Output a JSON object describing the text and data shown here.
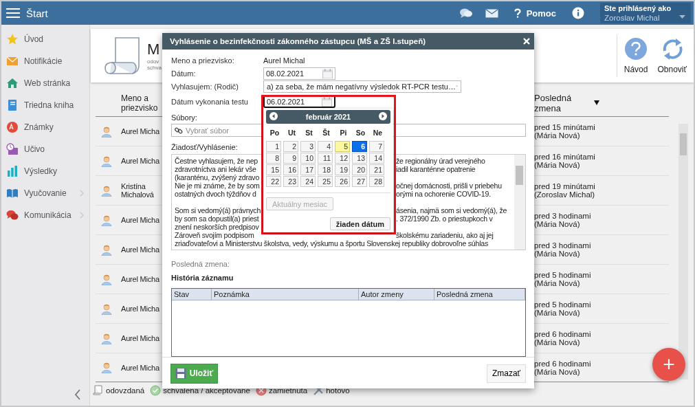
{
  "topbar": {
    "title": "Štart",
    "help": "Pomoc",
    "user_label": "Ste prihlásený ako",
    "user_name": "Zoroslav Michal"
  },
  "sidebar": {
    "items": [
      {
        "label": "Úvod",
        "expandable": false
      },
      {
        "label": "Notifikácie",
        "expandable": false
      },
      {
        "label": "Web stránka",
        "expandable": false
      },
      {
        "label": "Triedna kniha",
        "expandable": false
      },
      {
        "label": "Známky",
        "expandable": false
      },
      {
        "label": "Učivo",
        "expandable": false
      },
      {
        "label": "Výsledky",
        "expandable": false
      },
      {
        "label": "Vyučovanie",
        "expandable": true
      },
      {
        "label": "Komunikácia",
        "expandable": true
      }
    ]
  },
  "page_header": {
    "title": "M",
    "subtitle_lines": [
      "odov",
      "schva"
    ],
    "actions": [
      "Návod",
      "Obnoviť"
    ]
  },
  "list": {
    "columns": [
      "Meno a priezvisko",
      "Posledná zmena"
    ],
    "rows": [
      {
        "name": "Aurel Micha",
        "change": "pred 15 minútami",
        "author": "(Mária Nová)"
      },
      {
        "name": "Aurel Micha",
        "change": "pred 16 minútami",
        "author": "(Mária Nová)"
      },
      {
        "name": "Kristína Michalová",
        "change": "pred 19 minútami",
        "author": "(Zoroslav Michal)"
      },
      {
        "name": "Aurel Micha",
        "change": "pred 3 hodinami",
        "author": "(Mária Nová)"
      },
      {
        "name": "Aurel Micha",
        "change": "pred 3 hodinami",
        "author": "(Mária Nová)"
      },
      {
        "name": "Aurel Micha",
        "change": "pred 5 hodinami",
        "author": "(Mária Nová)"
      },
      {
        "name": "Aurel Micha",
        "change": "pred 5 hodinami",
        "author": "(Mária Nová)"
      },
      {
        "name": "Aurel Micha",
        "change": "pred 6 hodinami",
        "author": "(Mária Nová)"
      },
      {
        "name": "Aurel Micha",
        "change": "pred 6 hodinami",
        "author": "(Mária Nová)"
      }
    ]
  },
  "legend": [
    "odovzdaná",
    "schvalena / akceptovane",
    "zamietnuta",
    "hotovo"
  ],
  "fab": "+",
  "modal": {
    "title": "Vyhlásenie o bezinfekčnosti zákonného zástupcu (MŠ a ZŠ I.stupeň)",
    "name_label": "Meno a priezvisko:",
    "name_value": "Aurel Michal",
    "date_label": "Dátum:",
    "date_value": "08.02.2021",
    "declare_label": "Vyhlasujem: (Rodič)",
    "declare_value": "a) za seba, že mám negatívny výsledok RT-PCR testu…",
    "test_date_label": "Dátum vykonania testu",
    "test_date_value": "06.02.2021",
    "test_date_focused": true,
    "files_label": "Súbory:",
    "files_placeholder": "Vybrať súbor",
    "request_label": "Žiadosť/Vyhlásenie:",
    "request_lines": [
      {
        "left": "Čestne vyhlasujem, že nep",
        "right": "že regionálny úrad verejného"
      },
      {
        "left": "zdravotníctva ani lekár vše",
        "right": "iadil karanténne opatrenie"
      },
      {
        "left": "(karanténu, zvýšený zdravo"
      },
      {
        "left": "Nie je mi známe, že by som",
        "right": "očnej domácnosti, prišli v priebehu"
      },
      {
        "left": "ostatných dvoch týždňov d",
        "right": "orými na ochorenie COVID-19."
      },
      {
        "left": "Som si vedomý(á) právnych",
        "right": "ásenia, najmä som si vedomý(á), že",
        "paragraph_start": true
      },
      {
        "left": "by som sa dopustil(a) priest",
        "right": ". 372/1990 Zb. o priestupkoch v"
      },
      {
        "left": "znení neskorších predpisov"
      },
      {
        "left": "Zároveň svojím podpisom",
        "right": "školskému zariadeniu, ako aj jej"
      },
      {
        "left": "zriaďovateľovi a Ministerstvu školstva, vedy, výskumu a športu Slovenskej republiky dobrovoľne súhlas"
      }
    ],
    "last_change_label": "Posledná zmena:",
    "history_title": "História záznamu",
    "history_columns": [
      "Stav",
      "Poznámka",
      "Autor zmeny",
      "Posledná zmena"
    ],
    "save": "Uložiť",
    "delete": "Zmazať"
  },
  "calendar": {
    "month": "február 2021",
    "weekdays": [
      "Po",
      "Ut",
      "St",
      "Št",
      "Pi",
      "So",
      "Ne"
    ],
    "days": [
      {
        "label": "1",
        "selected": false,
        "today": false
      },
      {
        "label": "2",
        "selected": false,
        "today": false
      },
      {
        "label": "3",
        "selected": false,
        "today": false
      },
      {
        "label": "4",
        "selected": false,
        "today": false
      },
      {
        "label": "5",
        "selected": false,
        "today": true
      },
      {
        "label": "6",
        "selected": true,
        "today": false
      },
      {
        "label": "7",
        "selected": false,
        "today": false
      },
      {
        "label": "8",
        "selected": false,
        "today": false
      },
      {
        "label": "9",
        "selected": false,
        "today": false
      },
      {
        "label": "10",
        "selected": false,
        "today": false
      },
      {
        "label": "11",
        "selected": false,
        "today": false
      },
      {
        "label": "12",
        "selected": false,
        "today": false
      },
      {
        "label": "13",
        "selected": false,
        "today": false
      },
      {
        "label": "14",
        "selected": false,
        "today": false
      },
      {
        "label": "15",
        "selected": false,
        "today": false
      },
      {
        "label": "16",
        "selected": false,
        "today": false
      },
      {
        "label": "17",
        "selected": false,
        "today": false
      },
      {
        "label": "18",
        "selected": false,
        "today": false
      },
      {
        "label": "19",
        "selected": false,
        "today": false
      },
      {
        "label": "20",
        "selected": false,
        "today": false
      },
      {
        "label": "21",
        "selected": false,
        "today": false
      },
      {
        "label": "22",
        "selected": false,
        "today": false
      },
      {
        "label": "23",
        "selected": false,
        "today": false
      },
      {
        "label": "24",
        "selected": false,
        "today": false
      },
      {
        "label": "25",
        "selected": false,
        "today": false
      },
      {
        "label": "26",
        "selected": false,
        "today": false
      },
      {
        "label": "27",
        "selected": false,
        "today": false
      },
      {
        "label": "28",
        "selected": false,
        "today": false
      }
    ],
    "buttons": [
      {
        "label": "Aktuálny mesiac",
        "disabled": true
      },
      {
        "label": "žiaden dátum",
        "disabled": false
      }
    ]
  }
}
